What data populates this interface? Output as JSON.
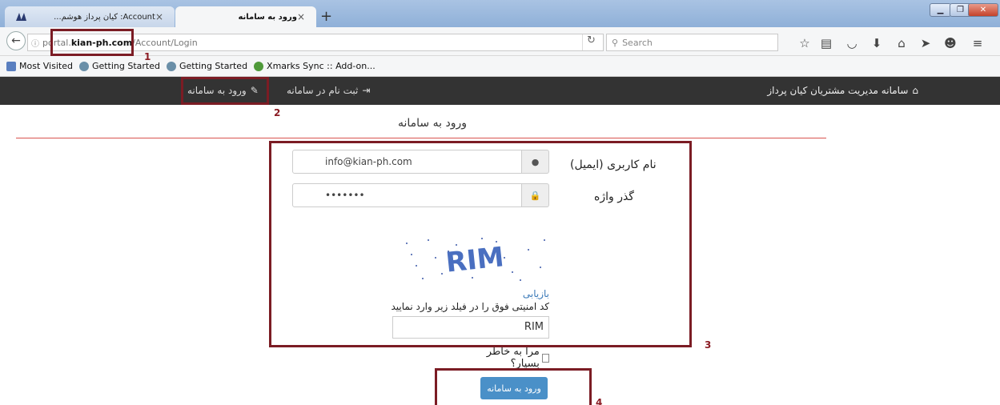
{
  "browser": {
    "tabs": [
      {
        "label": "Account: کیان پرداز هوشم..."
      },
      {
        "label": "ورود به سامانه"
      }
    ],
    "new_tab_symbol": "+",
    "tab_close_symbol": "×",
    "url": {
      "prefix": "portal.",
      "host": "kian-ph.com",
      "path": "/Account/Login"
    },
    "search_placeholder": "Search",
    "bookmarks": [
      "Most Visited",
      "Getting Started",
      "Getting Started",
      "Xmarks Sync :: Add-on..."
    ]
  },
  "site_nav": {
    "brand": "سامانه مدیریت مشتریان کیان پرداز",
    "register_link": "ثبت نام در سامانه",
    "login_link": "ورود به سامانه"
  },
  "page": {
    "title": "ورود به سامانه",
    "username_label": "نام کاربری (ایمیل)",
    "username_value": "info@kian-ph.com",
    "password_label": "گذر واژه",
    "password_value": "•••••••",
    "captcha_text": "RIM",
    "refresh_link": "بازیابی",
    "captcha_hint": "کد امنیتی فوق را در فیلد زیر وارد نمایید",
    "captcha_input_value": "RIM",
    "remember_label": "مرا به خاطر بسپار؟",
    "submit_label": "ورود به سامانه"
  },
  "annotations": [
    "1",
    "2",
    "3",
    "4"
  ],
  "colors": {
    "accent_button": "#4a90c8",
    "annotation": "#7b1c24",
    "divider": "#d9534f",
    "site_nav_bg": "#333333"
  }
}
